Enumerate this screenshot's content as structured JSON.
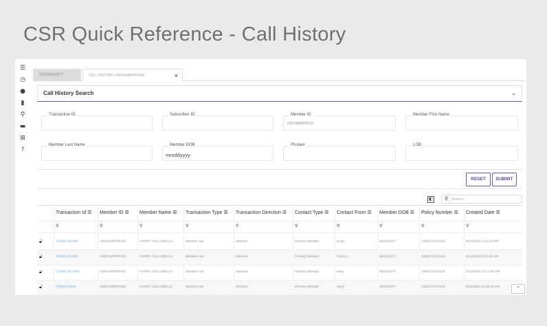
{
  "page": {
    "title": "CSR Quick Reference - Call History"
  },
  "rail_icons": [
    "menu-icon",
    "history-icon",
    "user-icon",
    "bar-chart-icon",
    "search-icon",
    "folder-icon",
    "hierarchy-icon",
    "help-icon"
  ],
  "tabs": [
    {
      "label": "TODORIENATY"
    },
    {
      "label": "CALL HISTORY LINEHAMRPRVIDA",
      "close": "×"
    }
  ],
  "panel": {
    "title": "Call History Search"
  },
  "search_form": {
    "transaction_id": {
      "label": "Transaction ID",
      "value": ""
    },
    "subscriber_id": {
      "label": "Subscriber ID",
      "value": ""
    },
    "member_id": {
      "label": "Member ID",
      "value": "1NEHAMRPRVID"
    },
    "member_first_name": {
      "label": "Member First Name",
      "value": ""
    },
    "member_last_name": {
      "label": "Member Last Name",
      "value": ""
    },
    "member_dob": {
      "label": "Member DOB",
      "value": "mmddyyyy"
    },
    "phone": {
      "label": "Phone#",
      "value": ""
    },
    "lob": {
      "label": "LOB",
      "value": ""
    }
  },
  "buttons": {
    "reset": "RESET",
    "submit": "SUBMIT"
  },
  "grid": {
    "search_placeholder": "Search...",
    "columns": [
      "Transaction Id",
      "Member ID",
      "Member Name",
      "Transaction Type",
      "Transaction Direction",
      "Contact Type",
      "Contact From",
      "Member DOB",
      "Policy Number",
      "Created Date"
    ],
    "rows": [
      [
        "712001 DVH25",
        "1NEHAMRPRVID",
        "HARRY HOLLIWELLS",
        "Member call",
        "Inbound",
        "Primary Member",
        "sindy",
        "06/22/1977",
        "1382271F31143",
        "6/13/2023 2:14:13 PM"
      ],
      [
        "712001 DV429",
        "1NEHAMRPRVID",
        "HARRY HOLLIWELLS",
        "Member call",
        "Inbound",
        "Primary Member",
        "Henry s",
        "06/22/1977",
        "1382271F31143",
        "6/13/2023 8:55:48 AM"
      ],
      [
        "712001 4C1640",
        "1NEHAMRPRVID",
        "HARRY HOLLIWELLS",
        "Member call",
        "Inbound",
        "Primary Member",
        "harry",
        "06/22/1977",
        "1382271F31143",
        "6/13/2023 12:13:35 PM"
      ],
      [
        "720450 94D9",
        "1NEHAMRPRVID",
        "HARRY HOLLIWELLS",
        "Member call",
        "Inbound",
        "Primary Member",
        "harry",
        "06/22/1977",
        "1382271F31143",
        "5/31/2023 11:09:45 AM"
      ]
    ]
  }
}
